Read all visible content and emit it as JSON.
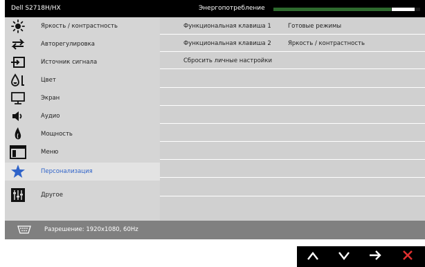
{
  "window": {
    "model": "Dell S2718H/HX",
    "energy_label": "Энергопотребление",
    "energy_level": 0.8
  },
  "menu": {
    "items": [
      {
        "label": "Яркость / контрастность",
        "icon": "brightness-icon",
        "selected": false
      },
      {
        "label": "Авторегулировка",
        "icon": "auto-adjust-icon",
        "selected": false
      },
      {
        "label": "Источник сигнала",
        "icon": "input-source-icon",
        "selected": false
      },
      {
        "label": "Цвет",
        "icon": "color-icon",
        "selected": false
      },
      {
        "label": "Экран",
        "icon": "display-icon",
        "selected": false
      },
      {
        "label": "Аудио",
        "icon": "audio-icon",
        "selected": false
      },
      {
        "label": "Мощность",
        "icon": "power-icon",
        "selected": false
      },
      {
        "label": "Меню",
        "icon": "menu-icon",
        "selected": false
      },
      {
        "label": "Персонализация",
        "icon": "star-icon",
        "selected": true
      },
      {
        "label": "Другое",
        "icon": "other-icon",
        "selected": false
      }
    ]
  },
  "content": {
    "rows": [
      {
        "label": "Функциональная клавиша 1",
        "value": "Готовые режимы"
      },
      {
        "label": "Функциональная клавиша 2",
        "value": "Яркость / контрастность"
      },
      {
        "label": "Сбросить личные настройки",
        "value": ""
      },
      {
        "label": "",
        "value": ""
      },
      {
        "label": "",
        "value": ""
      },
      {
        "label": "",
        "value": ""
      },
      {
        "label": "",
        "value": ""
      },
      {
        "label": "",
        "value": ""
      },
      {
        "label": "",
        "value": ""
      },
      {
        "label": "",
        "value": ""
      },
      {
        "label": "",
        "value": ""
      }
    ]
  },
  "status": {
    "resolution": "Разрешение: 1920x1080, 60Hz",
    "icon": "vga-connector-icon"
  },
  "nav": {
    "buttons": [
      {
        "name": "up-button",
        "icon": "arrow-up-icon"
      },
      {
        "name": "down-button",
        "icon": "arrow-down-icon"
      },
      {
        "name": "enter-button",
        "icon": "arrow-right-icon"
      },
      {
        "name": "exit-button",
        "icon": "close-icon"
      }
    ]
  },
  "colors": {
    "selected_text": "#2f63c9",
    "energy_fill": "#2e6a2e",
    "close": "#e03030"
  }
}
